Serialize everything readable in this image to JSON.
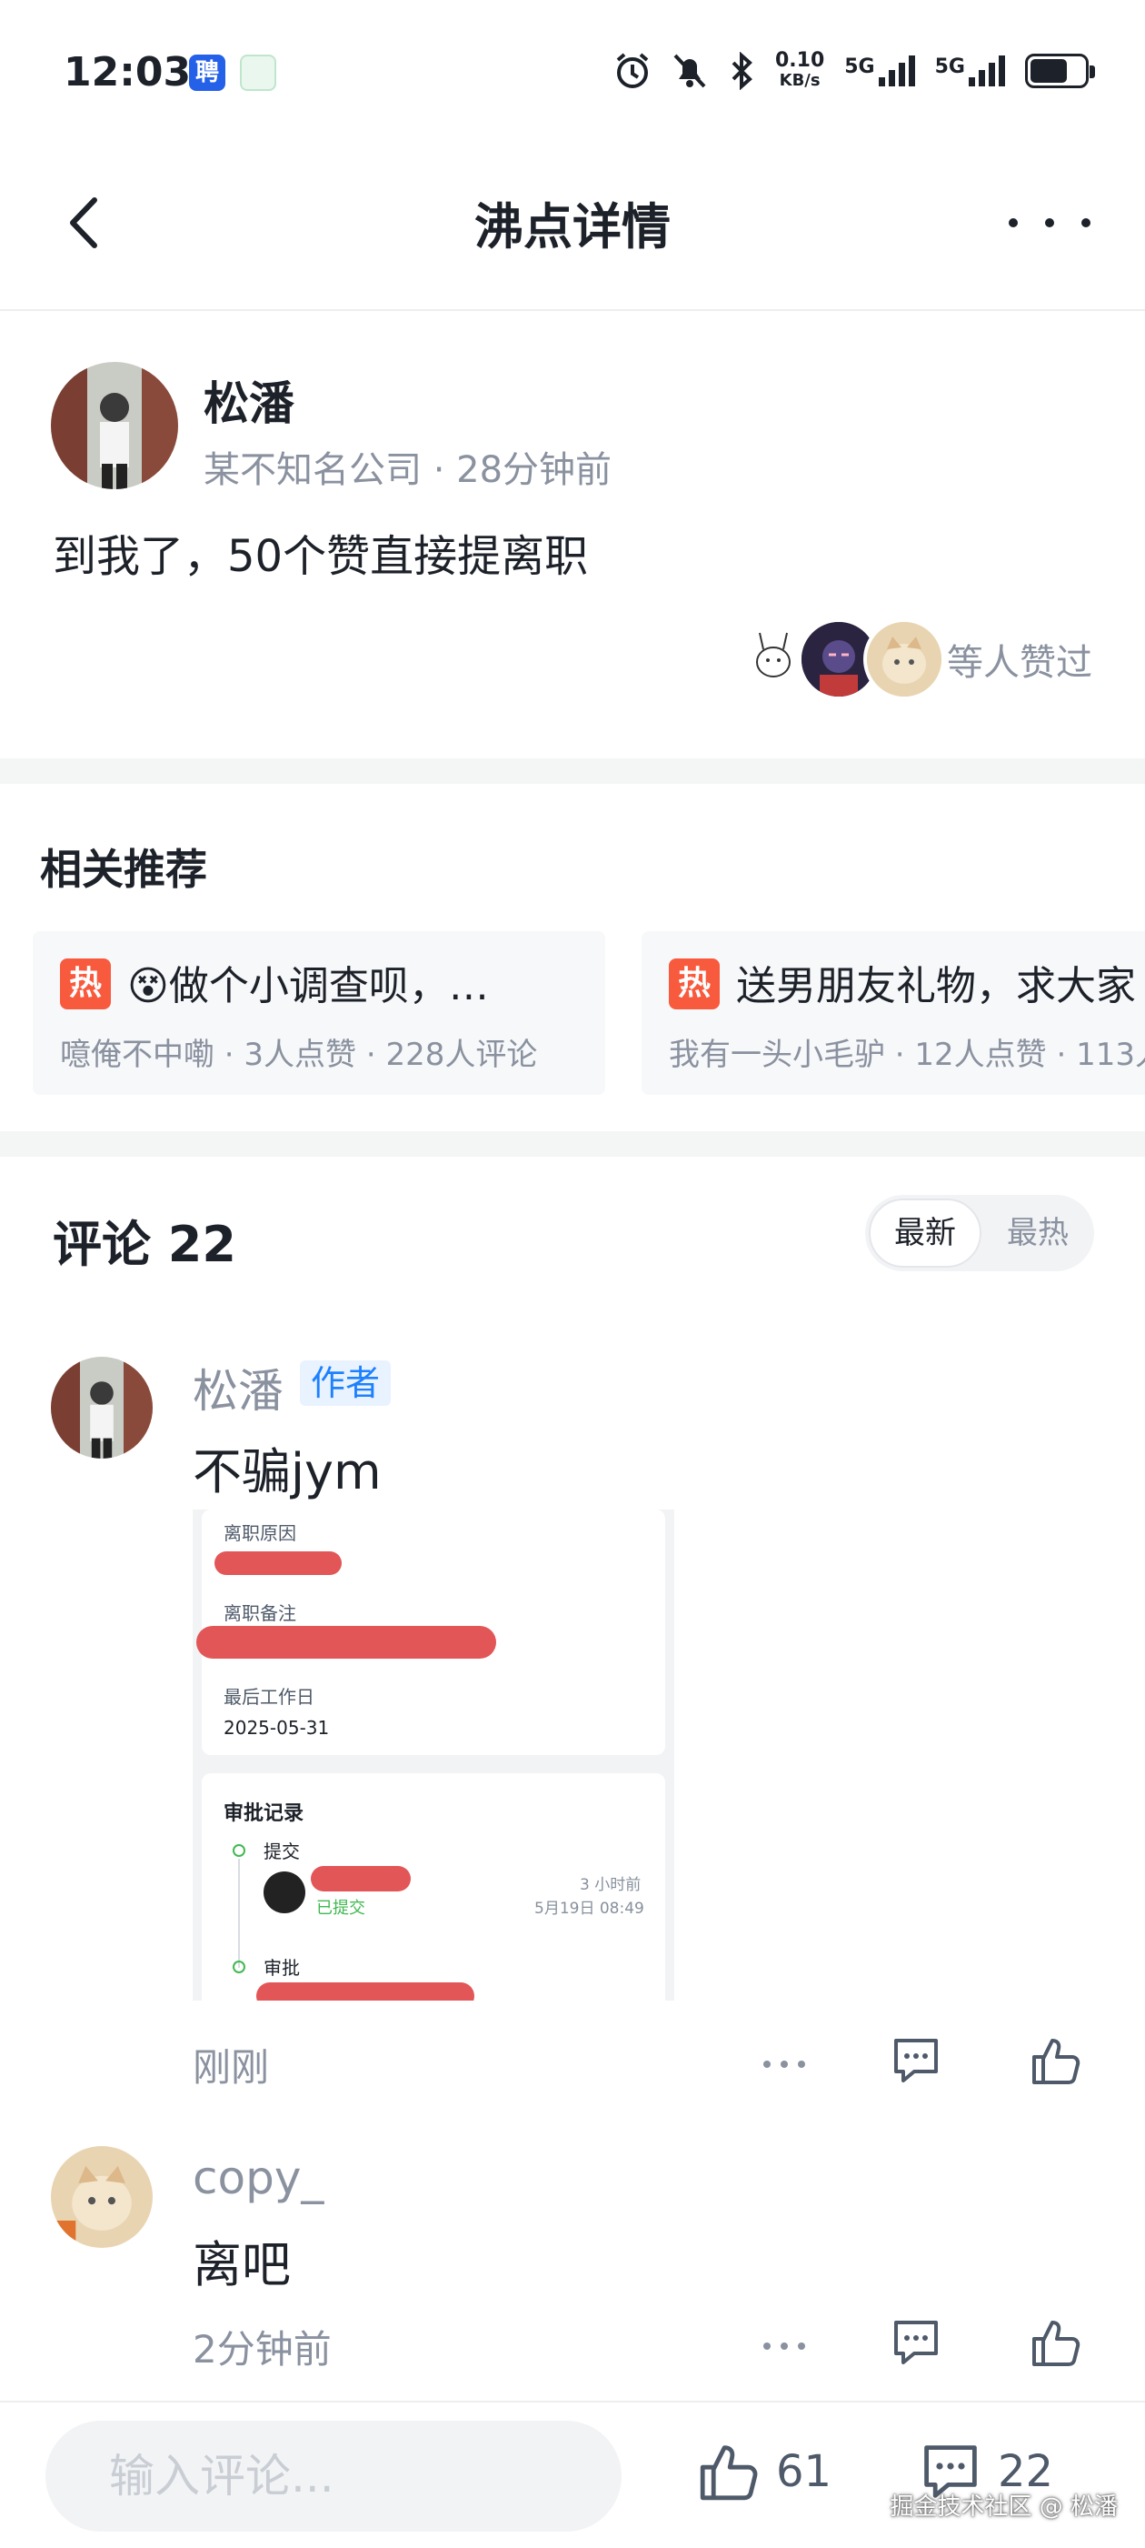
{
  "status_bar": {
    "time": "12:03",
    "net_speed": "0.10",
    "net_unit": "KB/s",
    "sim1": "5G",
    "sim2": "5G",
    "app_badge": "聘"
  },
  "header": {
    "title": "沸点详情"
  },
  "post": {
    "author": "松潘",
    "company": "某不知名公司",
    "time_ago": "28分钟前",
    "content": "到我了，50个赞直接提离职",
    "likes_text": "等人赞过"
  },
  "recommend": {
    "title": "相关推荐",
    "cards": [
      {
        "badge": "热",
        "title": "😵做个小调查呗，…",
        "meta": "噫俺不中嘞 · 3人点赞 · 228人评论"
      },
      {
        "badge": "热",
        "title": "送男朋友礼物，求大家",
        "meta": "我有一头小毛驴 · 12人点赞 · 113人"
      }
    ]
  },
  "comments": {
    "title": "评论 22",
    "sort_new": "最新",
    "sort_hot": "最热",
    "items": [
      {
        "name": "松潘",
        "badge": "作者",
        "text": "不骗jym",
        "time": "刚刚"
      },
      {
        "name": "copy_",
        "text": "离吧",
        "time": "2分钟前"
      }
    ],
    "screenshot": {
      "reason_label": "离职原因",
      "note_label": "离职备注",
      "lastday_label": "最后工作日",
      "lastday_value": "2025-05-31",
      "approval_title": "审批记录",
      "step1": "提交",
      "step1_status": "已提交",
      "step1_time1": "3 小时前",
      "step1_time2": "5月19日 08:49",
      "step2": "审批"
    }
  },
  "bottom_bar": {
    "input_placeholder": "输入评论...",
    "like_count": "61",
    "comment_count": "22",
    "watermark": "掘金技术社区 @ 松潘"
  }
}
